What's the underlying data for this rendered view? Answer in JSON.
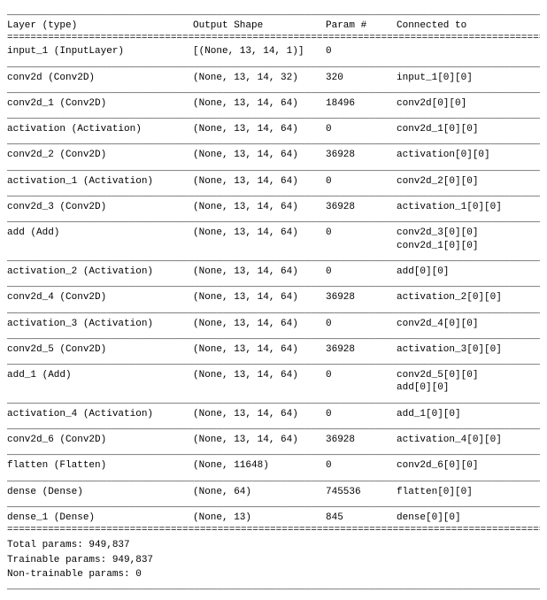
{
  "headers": {
    "layer": "Layer (type)",
    "shape": "Output Shape",
    "param": "Param #",
    "conn": "Connected to"
  },
  "rows": [
    {
      "layer": "input_1 (InputLayer)",
      "shape": "[(None, 13, 14, 1)]",
      "param": "0",
      "conn": [
        ""
      ]
    },
    {
      "layer": "conv2d (Conv2D)",
      "shape": "(None, 13, 14, 32)",
      "param": "320",
      "conn": [
        "input_1[0][0]"
      ]
    },
    {
      "layer": "conv2d_1 (Conv2D)",
      "shape": "(None, 13, 14, 64)",
      "param": "18496",
      "conn": [
        "conv2d[0][0]"
      ]
    },
    {
      "layer": "activation (Activation)",
      "shape": "(None, 13, 14, 64)",
      "param": "0",
      "conn": [
        "conv2d_1[0][0]"
      ]
    },
    {
      "layer": "conv2d_2 (Conv2D)",
      "shape": "(None, 13, 14, 64)",
      "param": "36928",
      "conn": [
        "activation[0][0]"
      ]
    },
    {
      "layer": "activation_1 (Activation)",
      "shape": "(None, 13, 14, 64)",
      "param": "0",
      "conn": [
        "conv2d_2[0][0]"
      ]
    },
    {
      "layer": "conv2d_3 (Conv2D)",
      "shape": "(None, 13, 14, 64)",
      "param": "36928",
      "conn": [
        "activation_1[0][0]"
      ]
    },
    {
      "layer": "add (Add)",
      "shape": "(None, 13, 14, 64)",
      "param": "0",
      "conn": [
        "conv2d_3[0][0]",
        "conv2d_1[0][0]"
      ]
    },
    {
      "layer": "activation_2 (Activation)",
      "shape": "(None, 13, 14, 64)",
      "param": "0",
      "conn": [
        "add[0][0]"
      ]
    },
    {
      "layer": "conv2d_4 (Conv2D)",
      "shape": "(None, 13, 14, 64)",
      "param": "36928",
      "conn": [
        "activation_2[0][0]"
      ]
    },
    {
      "layer": "activation_3 (Activation)",
      "shape": "(None, 13, 14, 64)",
      "param": "0",
      "conn": [
        "conv2d_4[0][0]"
      ]
    },
    {
      "layer": "conv2d_5 (Conv2D)",
      "shape": "(None, 13, 14, 64)",
      "param": "36928",
      "conn": [
        "activation_3[0][0]"
      ]
    },
    {
      "layer": "add_1 (Add)",
      "shape": "(None, 13, 14, 64)",
      "param": "0",
      "conn": [
        "conv2d_5[0][0]",
        "add[0][0]"
      ]
    },
    {
      "layer": "activation_4 (Activation)",
      "shape": "(None, 13, 14, 64)",
      "param": "0",
      "conn": [
        "add_1[0][0]"
      ]
    },
    {
      "layer": "conv2d_6 (Conv2D)",
      "shape": "(None, 13, 14, 64)",
      "param": "36928",
      "conn": [
        "activation_4[0][0]"
      ]
    },
    {
      "layer": "flatten (Flatten)",
      "shape": "(None, 11648)",
      "param": "0",
      "conn": [
        "conv2d_6[0][0]"
      ]
    },
    {
      "layer": "dense (Dense)",
      "shape": "(None, 64)",
      "param": "745536",
      "conn": [
        "flatten[0][0]"
      ]
    },
    {
      "layer": "dense_1 (Dense)",
      "shape": "(None, 13)",
      "param": "845",
      "conn": [
        "dense[0][0]"
      ]
    }
  ],
  "summary": {
    "total": "Total params: 949,837",
    "trainable": "Trainable params: 949,837",
    "nontrainable": "Non-trainable params: 0"
  },
  "divider_thick": "__________________________________________________________________________________________________",
  "divider_thin": "__________________________________________________________________________________________________",
  "divider_eq": "=================================================================================================="
}
